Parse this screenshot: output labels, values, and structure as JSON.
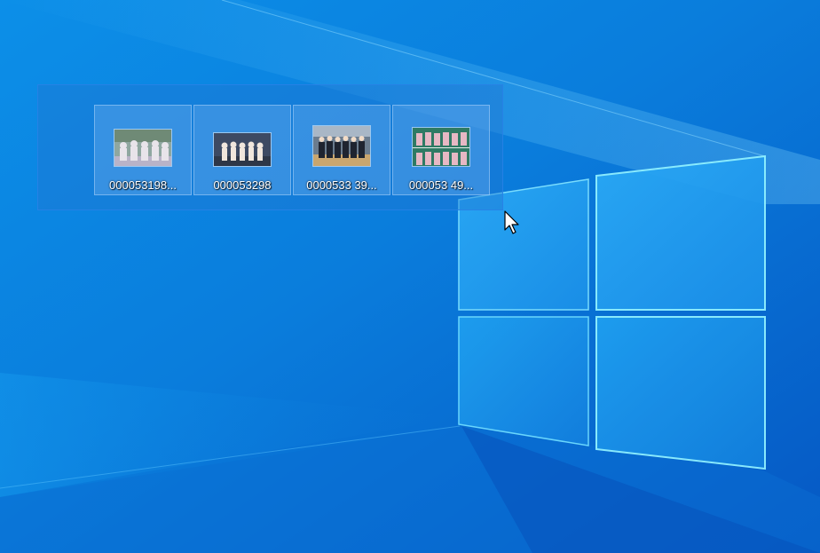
{
  "desktop": {
    "wallpaper": "windows-10-hero",
    "accent_color": "#0a78d8",
    "icons": [
      {
        "label": "000053198...",
        "icon": "image-thumbnail-icon",
        "selected": true
      },
      {
        "label": "000053298",
        "icon": "image-thumbnail-icon",
        "selected": true
      },
      {
        "label": "0000533 39...",
        "icon": "image-thumbnail-icon",
        "selected": true
      },
      {
        "label": "000053 49...",
        "icon": "image-thumbnail-icon",
        "selected": true
      }
    ]
  },
  "cursor": {
    "icon": "arrow-pointer-icon"
  }
}
